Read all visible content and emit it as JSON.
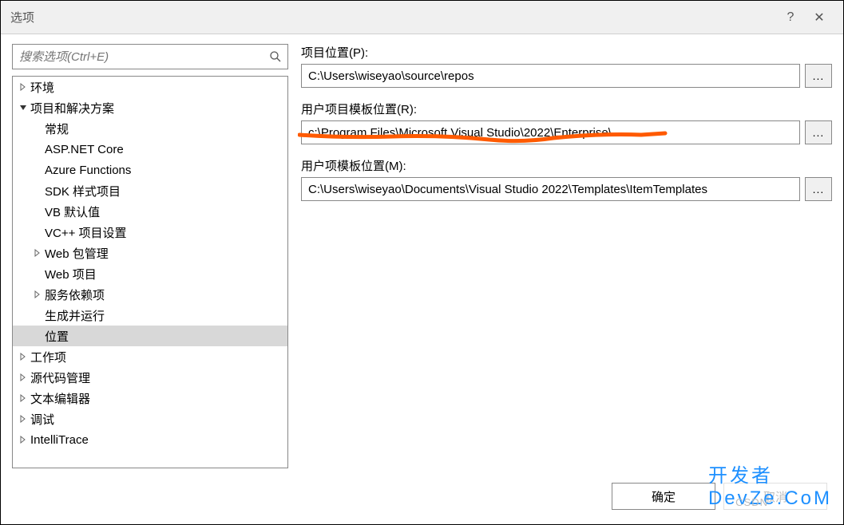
{
  "window": {
    "title": "选项",
    "help_icon": "?",
    "close_icon": "✕"
  },
  "search": {
    "placeholder": "搜索选项(Ctrl+E)"
  },
  "tree": [
    {
      "label": "环境",
      "indent": 0,
      "expander": "right",
      "selected": false
    },
    {
      "label": "项目和解决方案",
      "indent": 0,
      "expander": "down",
      "selected": false
    },
    {
      "label": "常规",
      "indent": 1,
      "expander": "none",
      "selected": false
    },
    {
      "label": "ASP.NET Core",
      "indent": 1,
      "expander": "none",
      "selected": false
    },
    {
      "label": "Azure Functions",
      "indent": 1,
      "expander": "none",
      "selected": false
    },
    {
      "label": "SDK 样式项目",
      "indent": 1,
      "expander": "none",
      "selected": false
    },
    {
      "label": "VB 默认值",
      "indent": 1,
      "expander": "none",
      "selected": false
    },
    {
      "label": "VC++ 项目设置",
      "indent": 1,
      "expander": "none",
      "selected": false
    },
    {
      "label": "Web 包管理",
      "indent": 1,
      "expander": "right",
      "selected": false
    },
    {
      "label": "Web 项目",
      "indent": 1,
      "expander": "none",
      "selected": false
    },
    {
      "label": "服务依赖项",
      "indent": 1,
      "expander": "right",
      "selected": false
    },
    {
      "label": "生成并运行",
      "indent": 1,
      "expander": "none",
      "selected": false
    },
    {
      "label": "位置",
      "indent": 1,
      "expander": "none",
      "selected": true
    },
    {
      "label": "工作项",
      "indent": 0,
      "expander": "right",
      "selected": false
    },
    {
      "label": "源代码管理",
      "indent": 0,
      "expander": "right",
      "selected": false
    },
    {
      "label": "文本编辑器",
      "indent": 0,
      "expander": "right",
      "selected": false
    },
    {
      "label": "调试",
      "indent": 0,
      "expander": "right",
      "selected": false
    },
    {
      "label": "IntelliTrace",
      "indent": 0,
      "expander": "right",
      "selected": false
    }
  ],
  "fields": {
    "project_location": {
      "label": "项目位置(P):",
      "value": "C:\\Users\\wiseyao\\source\\repos",
      "browse": "..."
    },
    "user_project_template": {
      "label": "用户项目模板位置(R):",
      "value": "c:\\Program Files\\Microsoft Visual Studio\\2022\\Enterprise\\",
      "browse": "..."
    },
    "user_item_template": {
      "label": "用户项模板位置(M):",
      "value": "C:\\Users\\wiseyao\\Documents\\Visual Studio 2022\\Templates\\ItemTemplates",
      "browse": "..."
    }
  },
  "footer": {
    "ok": "确定",
    "cancel": "取消"
  },
  "watermark": {
    "text1": "开发者",
    "text2": "DevZe.CoM",
    "small": "CSDN"
  },
  "colors": {
    "annotation": "#ff5a00"
  }
}
